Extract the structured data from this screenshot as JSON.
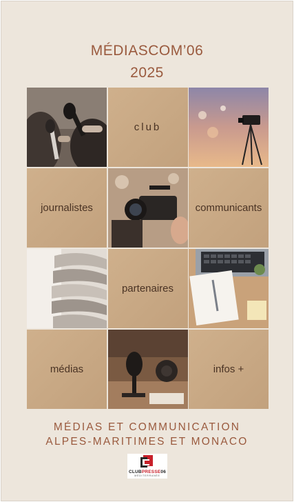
{
  "header": {
    "line1": "MÉDIASCOM’06",
    "line2": "2025"
  },
  "tiles": {
    "club": "club",
    "journalistes": "journalistes",
    "communicants": "communicants",
    "partenaires": "partenaires",
    "medias": "médias",
    "infos": "infos +"
  },
  "footer": {
    "line1": "MÉDIAS ET COMMUNICATION",
    "line2": "ALPES-MARITIMES ET MONACO"
  },
  "logo": {
    "part1": "CLUB",
    "part2": "PRESSE",
    "part3": "06",
    "tagline": "MÉDITERRANÉE"
  },
  "colors": {
    "background": "#ede6dc",
    "accent": "#9a5a3e",
    "tile": "#c9aa86"
  },
  "icons": {
    "tile1": "press-microphones-photo",
    "tile3": "video-camera-stage-photo",
    "tile5": "cinema-camera-photo",
    "tile7": "newspapers-photo",
    "tile9": "notebook-laptop-photo",
    "tile11": "studio-microphone-photo"
  }
}
